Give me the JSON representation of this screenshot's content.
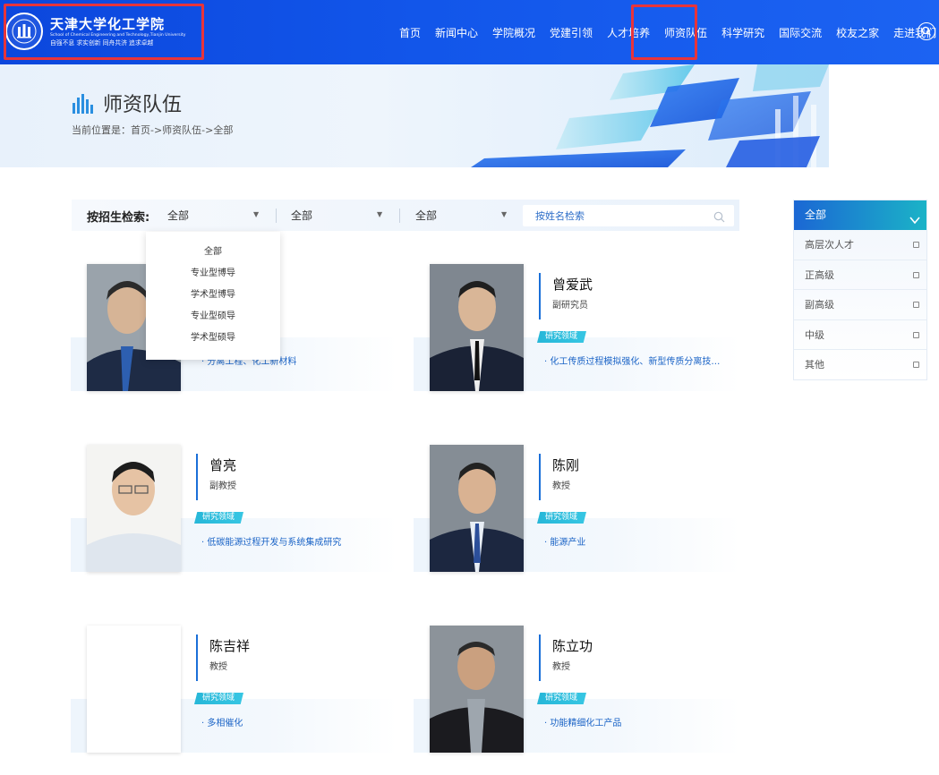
{
  "header": {
    "logo_cn": "天津大学化工学院",
    "logo_en": "School of Chemical Engineering and Technology,Tianjin University",
    "logo_motto": "自强不息 求实创新 同舟共济 追求卓越",
    "nav": [
      "首页",
      "新闻中心",
      "学院概况",
      "党建引领",
      "人才培养",
      "师资队伍",
      "科学研究",
      "国际交流",
      "校友之家",
      "走进我们"
    ]
  },
  "banner": {
    "title": "师资队伍",
    "breadcrumb": "当前位置是：首页->师资队伍->全部"
  },
  "filter": {
    "label": "按招生检索:",
    "select1": "全部",
    "select2": "全部",
    "select3": "全部",
    "search_placeholder": "按姓名检索",
    "dropdown_options": [
      "全部",
      "专业型博导",
      "学术型博导",
      "专业型硕导",
      "学术型硕导"
    ]
  },
  "cards": [
    {
      "name": "",
      "title": "",
      "tag": "",
      "field": "分离工程、化工新材料"
    },
    {
      "name": "曾爱武",
      "title": "副研究员",
      "tag": "研究领域",
      "field": "化工传质过程模拟强化、新型传质分离技术…"
    },
    {
      "name": "曾亮",
      "title": "副教授",
      "tag": "研究领域",
      "field": "低碳能源过程开发与系统集成研究"
    },
    {
      "name": "陈刚",
      "title": "教授",
      "tag": "研究领域",
      "field": "能源产业"
    },
    {
      "name": "陈吉祥",
      "title": "教授",
      "tag": "研究领域",
      "field": "多相催化"
    },
    {
      "name": "陈立功",
      "title": "教授",
      "tag": "研究领域",
      "field": "功能精细化工产品"
    }
  ],
  "sidebar": {
    "head": "全部",
    "items": [
      "高层次人才",
      "正高级",
      "副高级",
      "中级",
      "其他"
    ]
  },
  "colors": {
    "header_blue": "#1256ea",
    "accent_blue": "#1a6fd8",
    "tag_cyan": "#27b7d8",
    "highlight_red": "#e8343a"
  }
}
